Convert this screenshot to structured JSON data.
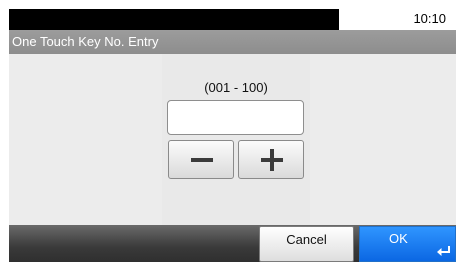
{
  "status_bar": {
    "time": "10:10"
  },
  "title_bar": {
    "title": "One Touch Key No. Entry"
  },
  "entry": {
    "range_label": "(001 - 100)",
    "value": "",
    "minus_icon": "minus-icon",
    "plus_icon": "plus-icon"
  },
  "footer": {
    "cancel_label": "Cancel",
    "ok_label": "OK",
    "enter_icon": "enter-icon"
  },
  "colors": {
    "ok_accent": "#1877f2",
    "title_bar": "#939393",
    "bottom_bar": "#3a3a3a"
  }
}
